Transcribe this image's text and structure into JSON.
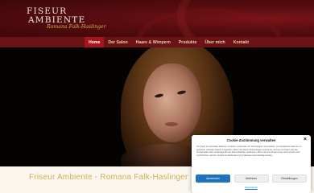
{
  "brand": {
    "logo_line1": "FISEUR",
    "logo_line2": "AMBIENTE",
    "logo_sub": "Romana Falk-Haslinger",
    "colors": {
      "header": "#5a0d10",
      "nav": "#6b1216",
      "nav_active": "#a8141b",
      "gold": "#d2b055"
    }
  },
  "nav": {
    "items": [
      {
        "label": "Home",
        "active": true
      },
      {
        "label": "Der Salon"
      },
      {
        "label": "Haare & Wimpern"
      },
      {
        "label": "Produkte"
      },
      {
        "label": "Über mich"
      },
      {
        "label": "Kontakt"
      }
    ]
  },
  "main": {
    "site_title": "Friseur Ambiente - Romana Falk-Haslinger"
  },
  "cookie": {
    "title": "Cookie-Zustimmung verwalten",
    "close_icon": "close-icon",
    "text": "Um Ihnen ein optimales Erlebnis zu bieten, verwenden wir Technologien wie Cookies, um Geräteinformationen zu speichern und/oder darauf zuzugreifen. Wenn Sie diesen Technologien zustimmen, können wir Daten wie das Surfverhalten oder eindeutige IDs auf dieser Website verarbeiten. Wenn Sie Ihre Zustimmung nicht erteilen oder zurückziehen, können bestimmte Merkmale und Funktionen beeinträchtigt werden.",
    "accept_label": "Annehmen",
    "deny_label": "Ablehnen",
    "settings_label": "Einstellungen",
    "link_label": "Datenschutz"
  }
}
